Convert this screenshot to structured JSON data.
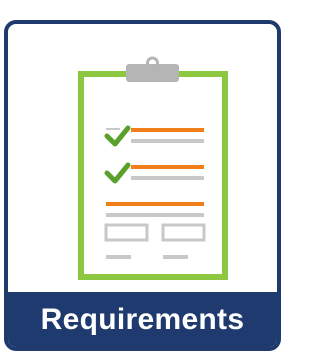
{
  "tile": {
    "label": "Requirements",
    "icon": "clipboard-checklist-icon",
    "colors": {
      "frame": "#1f3a6e",
      "clipboard_border": "#8dc63f",
      "accent_lines": "#f07f1a",
      "check_marks": "#5aa02c",
      "gray_lines": "#c8c8c8",
      "clip": "#b5b5b5"
    }
  }
}
